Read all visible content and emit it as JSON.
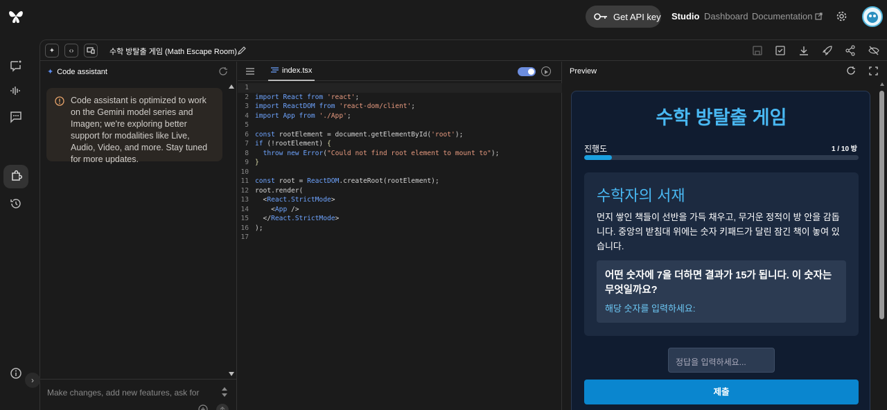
{
  "topbar": {
    "api_key_label": "Get API key",
    "nav_studio": "Studio",
    "nav_dashboard": "Dashboard",
    "nav_docs": "Documentation"
  },
  "toolbar": {
    "project_title": "수학 방탈출 게임 (Math Escape Room)"
  },
  "assistant": {
    "title": "Code assistant",
    "notice": "Code assistant is optimized to work on the Gemini model series and Imagen; we're exploring better support for modalities like Live, Audio, Video, and more. Stay tuned for more updates.",
    "prompt_placeholder": "Make changes, add new features, ask for"
  },
  "editor": {
    "file_tab": "index.tsx",
    "line_numbers": [
      "1",
      "2",
      "3",
      "4",
      "5",
      "6",
      "7",
      "8",
      "9",
      "10",
      "11",
      "12",
      "13",
      "14",
      "15",
      "16",
      "17"
    ]
  },
  "preview": {
    "title": "Preview",
    "game": {
      "title": "수학 방탈출 게임",
      "progress_label": "진행도",
      "progress_count": "1 / 10 방",
      "progress_fraction": 0.1,
      "room_title": "수학자의 서재",
      "room_desc": "먼지 쌓인 책들이 선반을 가득 채우고, 무거운 정적이 방 안을 감돕니다. 중앙의 받침대 위에는 숫자 키패드가 달린 잠긴 책이 놓여 있습니다.",
      "question": "어떤 숫자에 7을 더하면 결과가 15가 됩니다. 이 숫자는 무엇일까요?",
      "hint": "해당 숫자를 입력하세요:",
      "answer_placeholder": "정답을 입력하세요...",
      "submit_label": "제출"
    }
  }
}
